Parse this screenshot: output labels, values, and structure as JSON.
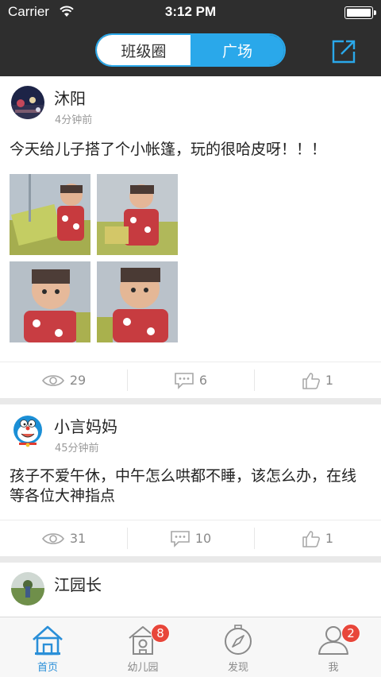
{
  "status_bar": {
    "carrier": "Carrier",
    "time": "3:12 PM"
  },
  "nav": {
    "segments": [
      {
        "label": "班级圈",
        "active": false
      },
      {
        "label": "广场",
        "active": true
      }
    ],
    "share_icon": "share-external-icon"
  },
  "posts": [
    {
      "user": "沐阳",
      "time": "4分钟前",
      "text": "今天给儿子搭了个小帐篷，玩的很哈皮呀！！！",
      "photo_count": 4,
      "views": "29",
      "comments": "6",
      "likes": "1"
    },
    {
      "user": "小言妈妈",
      "time": "45分钟前",
      "text": "孩子不爱午休，中午怎么哄都不睡，该怎么办，在线等各位大神指点",
      "views": "31",
      "comments": "10",
      "likes": "1"
    },
    {
      "user": "江园长"
    }
  ],
  "tabs": [
    {
      "label": "首页",
      "icon": "home-icon",
      "active": true
    },
    {
      "label": "幼儿园",
      "icon": "kindergarten-icon",
      "badge": "8"
    },
    {
      "label": "发现",
      "icon": "compass-icon"
    },
    {
      "label": "我",
      "icon": "person-icon",
      "badge": "2"
    }
  ],
  "colors": {
    "accent": "#2aa8ea",
    "dark": "#2e2e2e",
    "badge": "#e8463a"
  }
}
